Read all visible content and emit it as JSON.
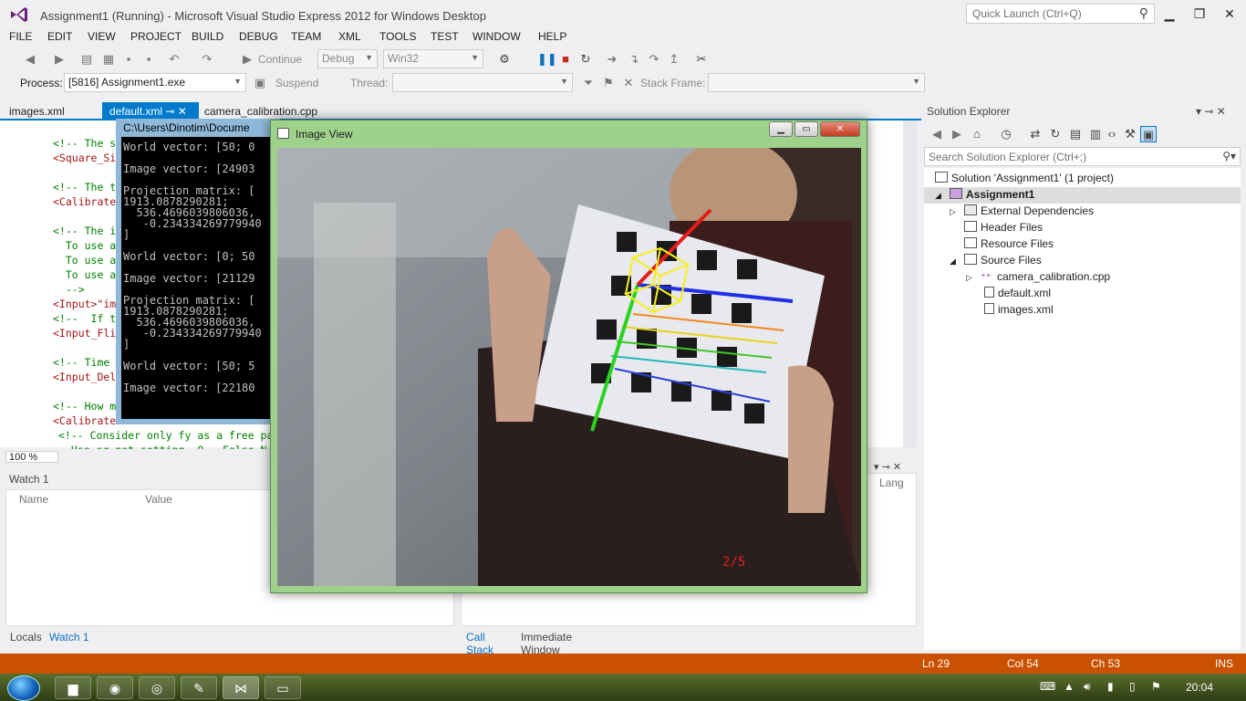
{
  "window": {
    "title": "Assignment1 (Running) - Microsoft Visual Studio Express 2012 for Windows Desktop",
    "quick_launch_placeholder": "Quick Launch (Ctrl+Q)"
  },
  "menu": [
    "FILE",
    "EDIT",
    "VIEW",
    "PROJECT",
    "BUILD",
    "DEBUG",
    "TEAM",
    "XML",
    "TOOLS",
    "TEST",
    "WINDOW",
    "HELP"
  ],
  "toolbar": {
    "continue_label": "Continue",
    "config": "Debug",
    "platform": "Win32",
    "process_label": "Process:",
    "process_value": "[5816] Assignment1.exe",
    "suspend_label": "Suspend",
    "thread_label": "Thread:",
    "stack_frame_label": "Stack Frame:"
  },
  "doc_tabs": [
    "images.xml",
    "default.xml",
    "camera_calibration.cpp"
  ],
  "editor": {
    "lines": [
      {
        "text": "<!-- The s",
        "kind": "comment"
      },
      {
        "text": "<Square_Si",
        "kind": "tag"
      },
      {
        "text": "<!-- The t",
        "kind": "comment"
      },
      {
        "text": "<Calibrate",
        "kind": "tag"
      },
      {
        "text": "<!-- The i",
        "kind": "comment"
      },
      {
        "text": "  To use a",
        "kind": "comment"
      },
      {
        "text": "  To use a",
        "kind": "comment"
      },
      {
        "text": "  To use a",
        "kind": "comment"
      },
      {
        "text": "  -->",
        "kind": "comment"
      },
      {
        "text": "<Input>\"im",
        "kind": "tag"
      },
      {
        "text": "<!--  If t",
        "kind": "comment"
      },
      {
        "text": "<Input_Fli",
        "kind": "tag"
      },
      {
        "text": "<!-- Time",
        "kind": "comment"
      },
      {
        "text": "<Input_Del",
        "kind": "tag"
      },
      {
        "text": "<!-- How m",
        "kind": "comment"
      },
      {
        "text": "<Calibrate",
        "kind": "tag"
      },
      {
        "text": "<!-- Consider only fy as a free pa",
        "kind": "comment"
      },
      {
        "text": "  Use or not setting. 0 - False N",
        "kind": "comment"
      }
    ],
    "zoom": "100 %"
  },
  "console": {
    "title": "C:\\Users\\Dinotim\\Docume",
    "lines": [
      "World vector: [50; 0",
      "",
      "Image vector: [24903",
      "",
      "Projection matrix: [",
      "1913.0878290281;",
      "  536.4696039806036,",
      "   -0.234334269779940",
      "]",
      "",
      "World vector: [0; 50",
      "",
      "Image vector: [21129",
      "",
      "Projection matrix: [",
      "1913.0878290281;",
      "  536.4696039806036,",
      "   -0.234334269779940",
      "]",
      "",
      "World vector: [50; 5",
      "",
      "Image vector: [22180"
    ]
  },
  "image_view": {
    "title": "Image View",
    "frame_counter": "2/5"
  },
  "watch": {
    "title": "Watch 1",
    "col_name": "Name",
    "col_value": "Value",
    "col_lang": "Lang"
  },
  "bottom_tabs": {
    "left": [
      "Locals",
      "Watch 1"
    ],
    "right": [
      "Call Stack",
      "Immediate Window"
    ]
  },
  "solution_explorer": {
    "title": "Solution Explorer",
    "search_placeholder": "Search Solution Explorer (Ctrl+;)",
    "tree": [
      {
        "label": "Solution 'Assignment1' (1 project)",
        "level": 0,
        "icon": "solution-icon"
      },
      {
        "label": "Assignment1",
        "level": 1,
        "icon": "project-icon"
      },
      {
        "label": "External Dependencies",
        "level": 2,
        "icon": "folder-dependencies-icon"
      },
      {
        "label": "Header Files",
        "level": 2,
        "icon": "folder-icon"
      },
      {
        "label": "Resource Files",
        "level": 2,
        "icon": "folder-icon"
      },
      {
        "label": "Source Files",
        "level": 2,
        "icon": "folder-icon"
      },
      {
        "label": "camera_calibration.cpp",
        "level": 3,
        "icon": "cpp-file-icon"
      },
      {
        "label": "default.xml",
        "level": 3,
        "icon": "xml-file-icon"
      },
      {
        "label": "images.xml",
        "level": 3,
        "icon": "xml-file-icon"
      }
    ]
  },
  "status_bar": {
    "line": "Ln 29",
    "col": "Col 54",
    "ch": "Ch 53",
    "mode": "INS",
    "color": "#ca5100"
  },
  "taskbar": {
    "clock": "20:04"
  },
  "colors": {
    "accent": "#007acc",
    "image_view_frame": "#9ed28a"
  }
}
